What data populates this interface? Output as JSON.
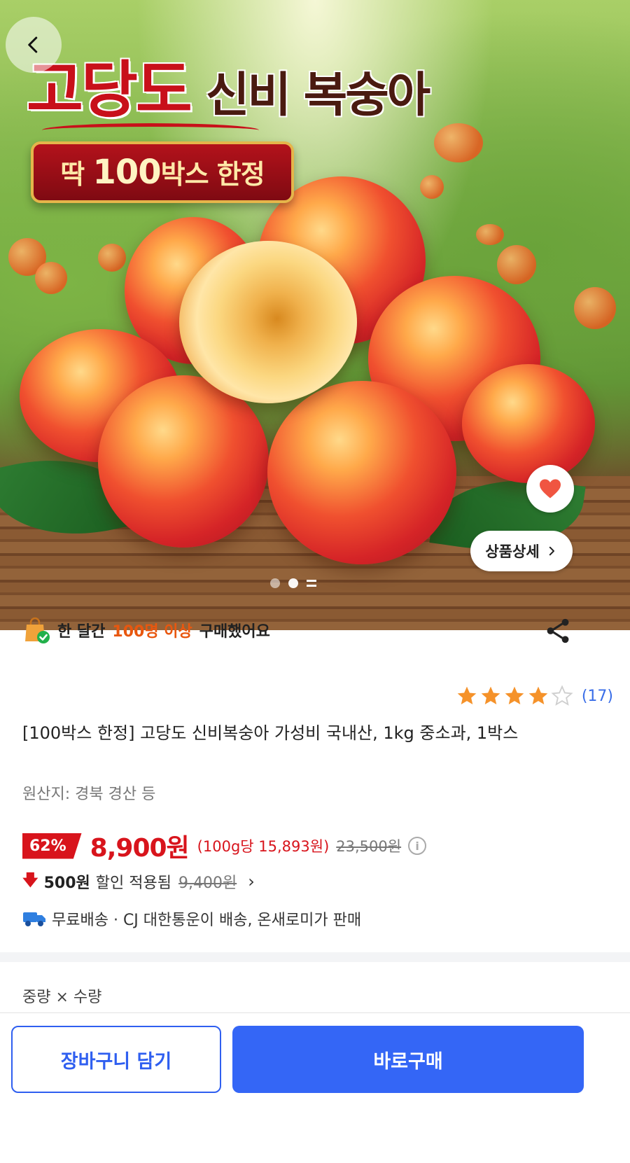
{
  "hero": {
    "title_part1": "고당도",
    "title_part2": "신비 복숭아",
    "badge_prefix": "딱",
    "badge_number": "100",
    "badge_suffix": "박스 한정",
    "detail_button_label": "상품상세",
    "carousel_active_index": 1,
    "carousel_dot_count": 3
  },
  "social_proof": {
    "prefix": "한 달간",
    "highlight": "100명 이상",
    "suffix": "구매했어요"
  },
  "rating": {
    "stars": 4,
    "max_stars": 5,
    "count": "(17)"
  },
  "product": {
    "title": "[100박스 한정] 고당도 신비복숭아 가성비 국내산, 1kg 중소과, 1박스",
    "origin": "원산지: 경북 경산 등"
  },
  "price": {
    "discount_rate": "62%",
    "sale_price": "8,900원",
    "unit_price": "(100g당 15,893원)",
    "original_price": "23,500원",
    "coupon_amount": "500원",
    "coupon_text": "할인 적용됨",
    "pre_coupon_price": "9,400원"
  },
  "delivery": {
    "text": "무료배송 · CJ 대한통운이 배송, 온새로미가 판매"
  },
  "options": {
    "label": "중량 × 수량"
  },
  "actions": {
    "cart_label": "장바구니 담기",
    "buy_label": "바로구매"
  },
  "colors": {
    "accent_blue": "#3466f6",
    "price_red": "#d8141c",
    "highlight_orange": "#e8570f",
    "star_orange": "#f5922a"
  }
}
